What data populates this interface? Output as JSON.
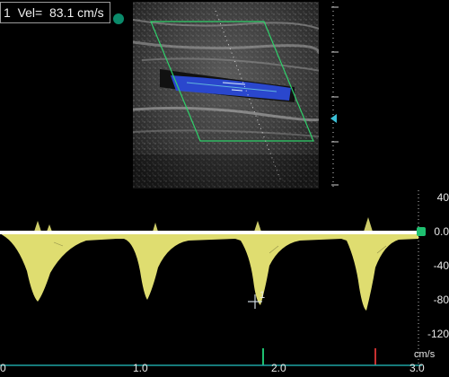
{
  "measurement": {
    "readout": "1  Vel=  83.1 cm/s"
  },
  "colors": {
    "spectrum": "#f2f07a",
    "baseline": "#ffffff",
    "color_box": "#2fd06a",
    "flow": "#2c4bd8",
    "time_axis": "#1ea2a2",
    "marker_green": "#1ec070",
    "marker_red": "#c83030"
  },
  "velocity_scale": {
    "unit": "cm/s",
    "ticks": [
      "40",
      "0.0",
      "-40",
      "-80",
      "-120"
    ]
  },
  "time_scale": {
    "ticks": [
      "0",
      "1.0",
      "2.0",
      "3.0"
    ]
  },
  "cursor": {
    "label": "1"
  }
}
